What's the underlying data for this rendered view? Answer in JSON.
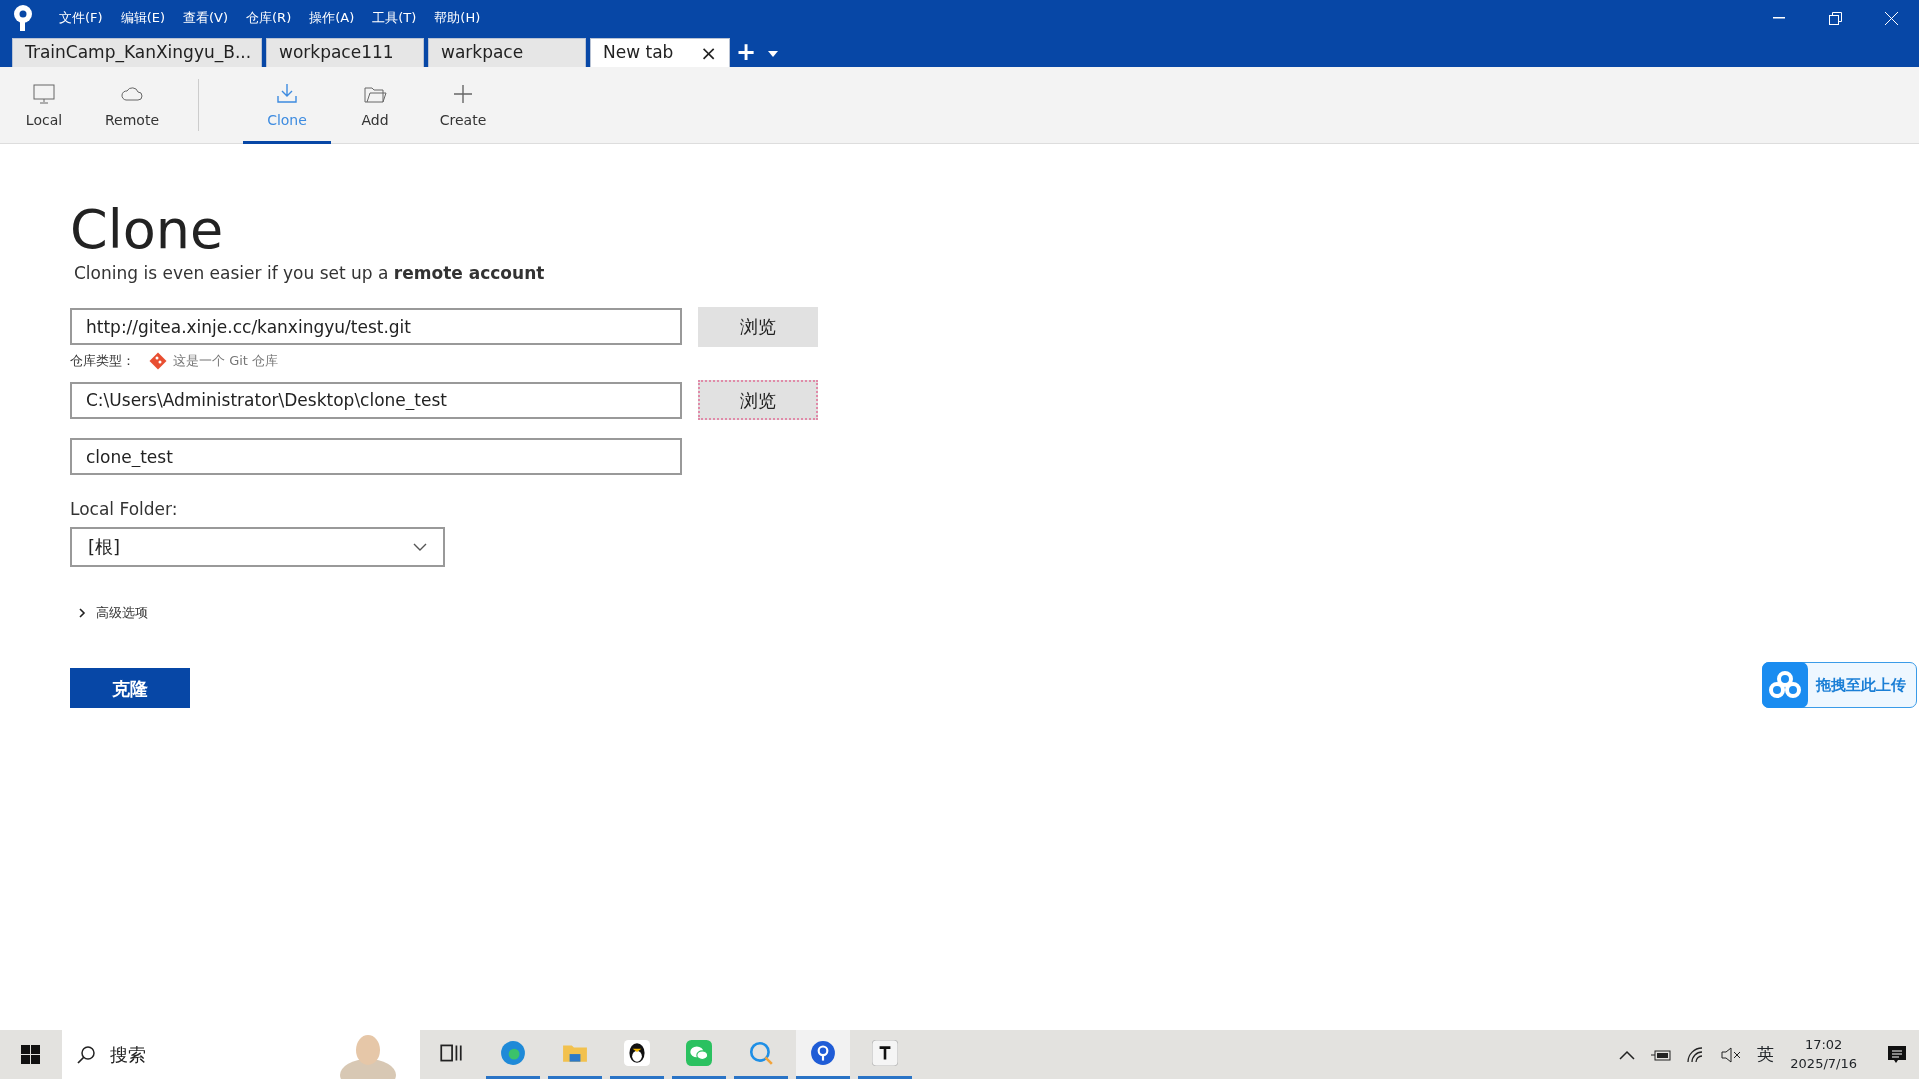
{
  "menu": [
    "文件(F)",
    "编辑(E)",
    "查看(V)",
    "仓库(R)",
    "操作(A)",
    "工具(T)",
    "帮助(H)"
  ],
  "tabs": [
    {
      "label": "TrainCamp_KanXingyu_B...",
      "selected": false
    },
    {
      "label": "workpace111",
      "selected": false
    },
    {
      "label": "warkpace",
      "selected": false
    },
    {
      "label": "New tab",
      "selected": true,
      "close": "×"
    }
  ],
  "new_tab": "+",
  "toolbar": [
    {
      "kind": "local",
      "label": "Local",
      "selected": false
    },
    {
      "kind": "remote",
      "label": "Remote",
      "selected": false
    },
    {
      "kind": "clone",
      "label": "Clone",
      "selected": true
    },
    {
      "kind": "add",
      "label": "Add",
      "selected": false
    },
    {
      "kind": "create",
      "label": "Create",
      "selected": false
    }
  ],
  "clone": {
    "title": "Clone",
    "subtitle": "Cloning is even easier if you set up a **remote account**",
    "source_url": "http://gitea.xinje.cc/kanxingyu/test.git",
    "source_browse": {
      "label": "浏览",
      "focused": false
    },
    "repo_type_label": "仓库类型：",
    "repo_type": "这是一个 Git 仓库",
    "destination_path": "C:\\Users\\Administrator\\Desktop\\clone_test",
    "destination_browse": {
      "label": "浏览",
      "focused": true
    },
    "name": "clone_test",
    "local_folder_label": "Local Folder:",
    "local_folder": "[根]",
    "advanced": {
      "label": "高级选项",
      "expanded": false
    },
    "submit": "克隆"
  },
  "upload_widget": "拖拽至此上传",
  "taskbar": {
    "search_placeholder": "搜索",
    "apps": [
      {
        "kind": "taskview",
        "running": false,
        "selected": false
      },
      {
        "kind": "edge",
        "running": true,
        "selected": false
      },
      {
        "kind": "folder",
        "running": true,
        "selected": false
      },
      {
        "kind": "penguin",
        "running": true,
        "selected": false
      },
      {
        "kind": "chat",
        "running": true,
        "selected": false
      },
      {
        "kind": "bubble",
        "running": true,
        "selected": false
      },
      {
        "kind": "pin",
        "running": true,
        "selected": true
      },
      {
        "kind": "typora",
        "running": true,
        "selected": false
      }
    ],
    "ime": "英",
    "time": "17:02",
    "date": "2025/7/16"
  }
}
